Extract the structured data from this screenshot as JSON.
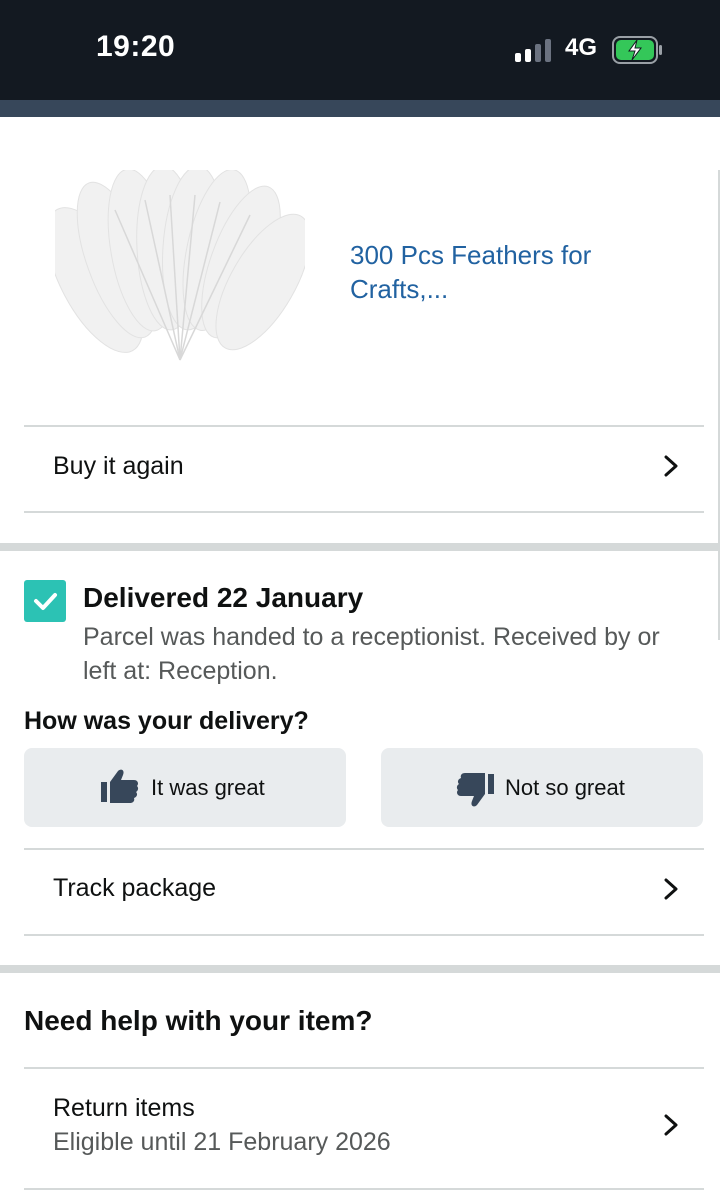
{
  "status_bar": {
    "time": "19:20",
    "network": "4G",
    "signal_icon": "signal-bars-icon",
    "battery_icon": "battery-charging-icon"
  },
  "product": {
    "title": "300 Pcs Feathers for Crafts,...",
    "image_icon": "white-feathers-image"
  },
  "actions": {
    "buy_again": "Buy it again",
    "track_package": "Track package"
  },
  "delivery": {
    "status": "Delivered 22 January",
    "detail": "Parcel was handed to a receptionist. Received by or left at: Reception.",
    "question": "How was your delivery?",
    "great_label": "It was great",
    "not_great_label": "Not so great"
  },
  "help": {
    "title": "Need help with your item?",
    "return_label": "Return items",
    "return_sub": "Eligible until 21 February 2026"
  },
  "colors": {
    "status_bar_bg": "#131921",
    "header_strip": "#37475a",
    "link": "#2162a1",
    "check_teal": "#2cc2b4",
    "button_bg": "#e9ecee",
    "divider": "#d5d9d9"
  }
}
